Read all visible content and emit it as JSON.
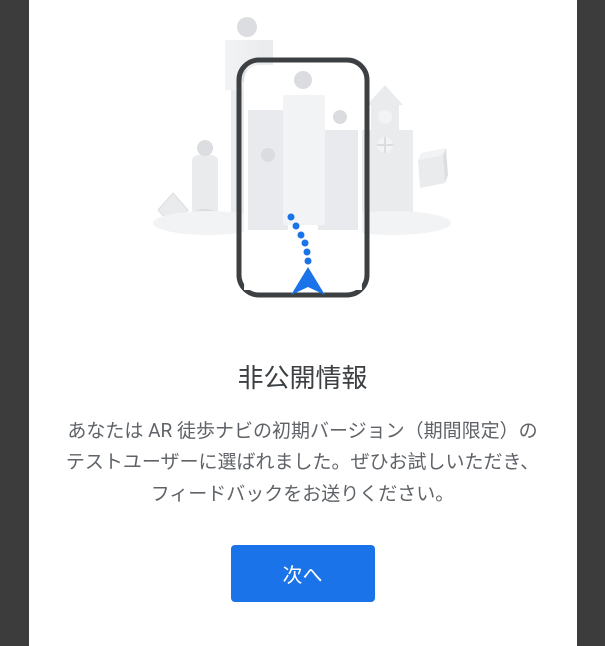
{
  "dialog": {
    "title": "非公開情報",
    "description": "あなたは AR 徒歩ナビの初期バージョン（期間限定）のテストユーザーに選ばれました。ぜひお試しいただき、フィードバックをお送りください。",
    "button_label": "次へ"
  },
  "colors": {
    "primary": "#1a73e8",
    "title_text": "#3c4043",
    "body_text": "#5f6368",
    "dialog_bg": "#ffffff",
    "backdrop": "#3c3c3c"
  },
  "illustration": {
    "description": "ar-navigation-city-scene",
    "elements": [
      "phone-frame",
      "city-buildings",
      "navigation-arrow",
      "dotted-path"
    ]
  }
}
